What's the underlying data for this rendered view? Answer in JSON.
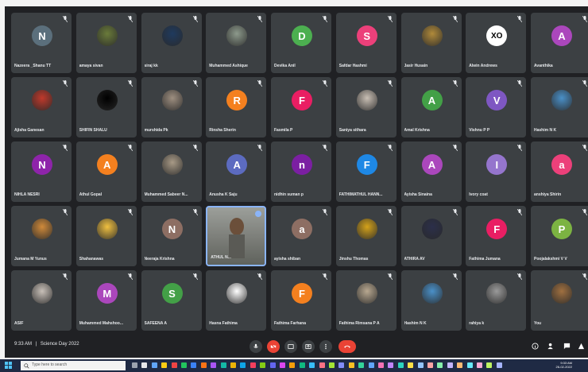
{
  "participants": [
    {
      "name": "Nazeera _Shanu TT",
      "initial": "N",
      "color": "#5b6f7c",
      "kind": "letter"
    },
    {
      "name": "amaya sivan",
      "initial": "",
      "color": "#6a7b3a",
      "kind": "photo"
    },
    {
      "name": "siraj kk",
      "initial": "",
      "color": "#1f3a5e",
      "kind": "photo"
    },
    {
      "name": "Muhammed Ashique",
      "initial": "",
      "color": "#8d9a8c",
      "kind": "photo"
    },
    {
      "name": "Devika Anil",
      "initial": "D",
      "color": "#4caf50",
      "kind": "letter"
    },
    {
      "name": "Safdar Hashmi",
      "initial": "S",
      "color": "#ec407a",
      "kind": "letter"
    },
    {
      "name": "Jasir Husain",
      "initial": "",
      "color": "#b08a3a",
      "kind": "photo"
    },
    {
      "name": "Alwin Andrews",
      "initial": "XO",
      "color": "#ffffff",
      "kind": "logo"
    },
    {
      "name": "Avanthika",
      "initial": "A",
      "color": "#ab47bc",
      "kind": "letter"
    },
    {
      "name": "Ajisha Ganesan",
      "initial": "",
      "color": "#c0392b",
      "kind": "photo"
    },
    {
      "name": "SHIFIN SHALU",
      "initial": "",
      "color": "#000000",
      "kind": "photo"
    },
    {
      "name": "murshida Pk",
      "initial": "",
      "color": "#9e8f80",
      "kind": "photo"
    },
    {
      "name": "Rinsha Sherin",
      "initial": "R",
      "color": "#f4801f",
      "kind": "letter"
    },
    {
      "name": "Fasmila P",
      "initial": "F",
      "color": "#e91e63",
      "kind": "letter"
    },
    {
      "name": "Saniya sithara",
      "initial": "",
      "color": "#c9bfb4",
      "kind": "photo"
    },
    {
      "name": "Amal Krishna",
      "initial": "A",
      "color": "#43a047",
      "kind": "letter"
    },
    {
      "name": "Vishnu P P",
      "initial": "V",
      "color": "#7e57c2",
      "kind": "letter"
    },
    {
      "name": "Hashim N K",
      "initial": "",
      "color": "#4a90c8",
      "kind": "photo"
    },
    {
      "name": "NIHLA NESRI",
      "initial": "N",
      "color": "#8e24aa",
      "kind": "letter"
    },
    {
      "name": "Athul Gopal",
      "initial": "A",
      "color": "#f4801f",
      "kind": "letter"
    },
    {
      "name": "Muhammed Sabeer N...",
      "initial": "",
      "color": "#a89a86",
      "kind": "photo"
    },
    {
      "name": "Anusha K Saju",
      "initial": "A",
      "color": "#5c6bc0",
      "kind": "letter"
    },
    {
      "name": "nidhin suman p",
      "initial": "n",
      "color": "#7b1fa2",
      "kind": "letter"
    },
    {
      "name": "FATHIMATHUL HANN...",
      "initial": "F",
      "color": "#1e88e5",
      "kind": "letter"
    },
    {
      "name": "Ayisha Sinaina",
      "initial": "A",
      "color": "#ab47bc",
      "kind": "letter"
    },
    {
      "name": "Ivory coat",
      "initial": "I",
      "color": "#9575cd",
      "kind": "letter"
    },
    {
      "name": "anshiya Shirin",
      "initial": "a",
      "color": "#ec407a",
      "kind": "letter"
    },
    {
      "name": "Jumana M Yunus",
      "initial": "",
      "color": "#d08a3a",
      "kind": "photo"
    },
    {
      "name": "Shahanawas",
      "initial": "",
      "color": "#f0c040",
      "kind": "photo"
    },
    {
      "name": "Neeraja Krishna",
      "initial": "N",
      "color": "#8d6e63",
      "kind": "letter"
    },
    {
      "name": "ATHUL N...",
      "initial": "",
      "color": "#888888",
      "kind": "video"
    },
    {
      "name": "ayisha shiban",
      "initial": "a",
      "color": "#8d6e63",
      "kind": "letter"
    },
    {
      "name": "Jinshu Thomas",
      "initial": "",
      "color": "#d4a21a",
      "kind": "photo"
    },
    {
      "name": "ATHIRA AV",
      "initial": "",
      "color": "#2b2f4a",
      "kind": "photo"
    },
    {
      "name": "Fathima Jumana",
      "initial": "F",
      "color": "#e91e63",
      "kind": "letter"
    },
    {
      "name": "Poojalakshmi V V",
      "initial": "P",
      "color": "#7cb342",
      "kind": "letter"
    },
    {
      "name": "ASIF",
      "initial": "",
      "color": "#c8c0b8",
      "kind": "photo"
    },
    {
      "name": "Muhammed Mahshoo...",
      "initial": "M",
      "color": "#ab47bc",
      "kind": "letter"
    },
    {
      "name": "SAFEENA A",
      "initial": "S",
      "color": "#43a047",
      "kind": "letter"
    },
    {
      "name": "Hasna Fathima",
      "initial": "",
      "color": "#ffffff",
      "kind": "photo"
    },
    {
      "name": "Fathima Farhana",
      "initial": "F",
      "color": "#f4801f",
      "kind": "letter"
    },
    {
      "name": "Fathima Rimsana P A",
      "initial": "",
      "color": "#b8a890",
      "kind": "photo"
    },
    {
      "name": "Hashim N K",
      "initial": "",
      "color": "#4a90c8",
      "kind": "photo"
    },
    {
      "name": "rahiya k",
      "initial": "",
      "color": "#9a9a9a",
      "kind": "photo"
    },
    {
      "name": "You",
      "initial": "",
      "color": "#a07040",
      "kind": "photo"
    }
  ],
  "meeting": {
    "time": "9:33 AM",
    "separator": "|",
    "title": "Science Day 2022"
  },
  "taskbar": {
    "search_placeholder": "Type here to search",
    "clock_time": "9:33 AM",
    "clock_date": "26-02-2022"
  },
  "colors": {
    "meet_bg": "#202124",
    "tile_bg": "#3c4043",
    "end_call": "#ea4335",
    "taskbar_bg": "#1f2a44"
  }
}
